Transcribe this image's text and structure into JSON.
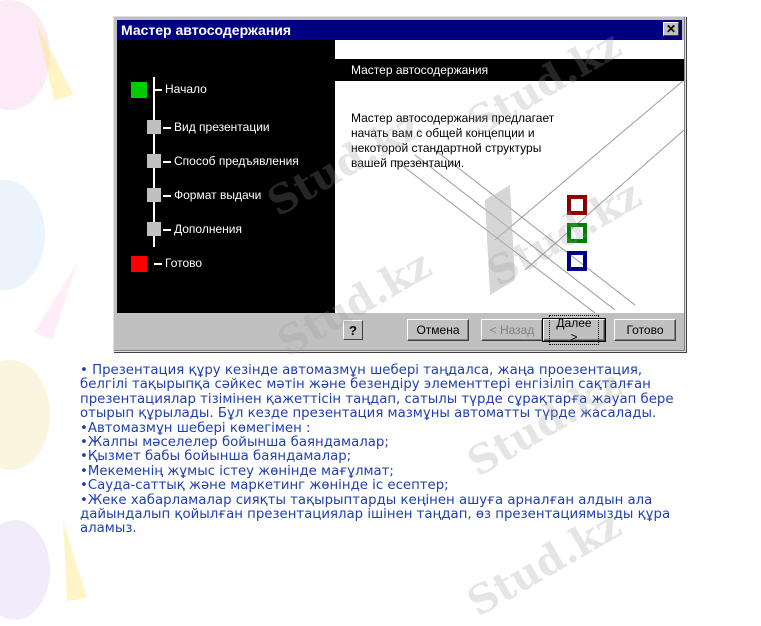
{
  "dialog": {
    "title": "Мастер автосодержания",
    "close_glyph": "✕",
    "steps": [
      {
        "label": "Начало",
        "color": "#00cc00"
      },
      {
        "label": "Вид презентации",
        "color": "#c0c0c0"
      },
      {
        "label": "Способ предъявления",
        "color": "#c0c0c0"
      },
      {
        "label": "Формат выдачи",
        "color": "#c0c0c0"
      },
      {
        "label": "Дополнения",
        "color": "#c0c0c0"
      },
      {
        "label": "Готово",
        "color": "#ff0000"
      }
    ],
    "panel_title": "Мастер автосодержания",
    "panel_desc_lines": [
      "Мастер автосодержания предлагает",
      "начать вам с общей концепции и",
      "некоторой стандартной структуры",
      "вашей презентации."
    ],
    "help_glyph": "?",
    "buttons": {
      "cancel": "Отмена",
      "back": "< Назад",
      "next": "Далее >",
      "finish": "Готово"
    },
    "accent_squares": [
      "#8b0000",
      "#008000",
      "#000080"
    ]
  },
  "body_lines": [
    "•  Презентация құру кезінде автомазмұн шебері таңдалса, жаңа проезентация,",
    "белгілі тақырыпқа сәйкес мәтін және безендіру элементтері енгізіліп сақталған",
    "презентациялар тізімінен қажеттісін таңдап, сатылы түрде сұрақтарға жауап бере",
    "отырып құрылады. Бұл кезде презентация мазмұны автоматты түрде жасалады.",
    "•Автомазмұн шебері көмегімен :",
    "•Жалпы мәселелер бойынша баяндамалар;",
    "•Қызмет бабы бойынша баяндамалар;",
    "•Мекеменің жұмыс істеу жөнінде мағұлмат;",
    "•Сауда-саттық және маркетинг жөнінде іс есептер;",
    "•Жеке хабарламалар сияқты тақырыптарды кеңінен ашуға арналған алдын ала",
    "дайындалып қойылған презентациялар ішінен  таңдап, өз презентациямызды құра",
    "аламыз."
  ],
  "watermarks": [
    "Stud.kz",
    "Stud.kz",
    "Stud.kz",
    "Stud.kz",
    "Stud.kz",
    "Stud.kz"
  ]
}
